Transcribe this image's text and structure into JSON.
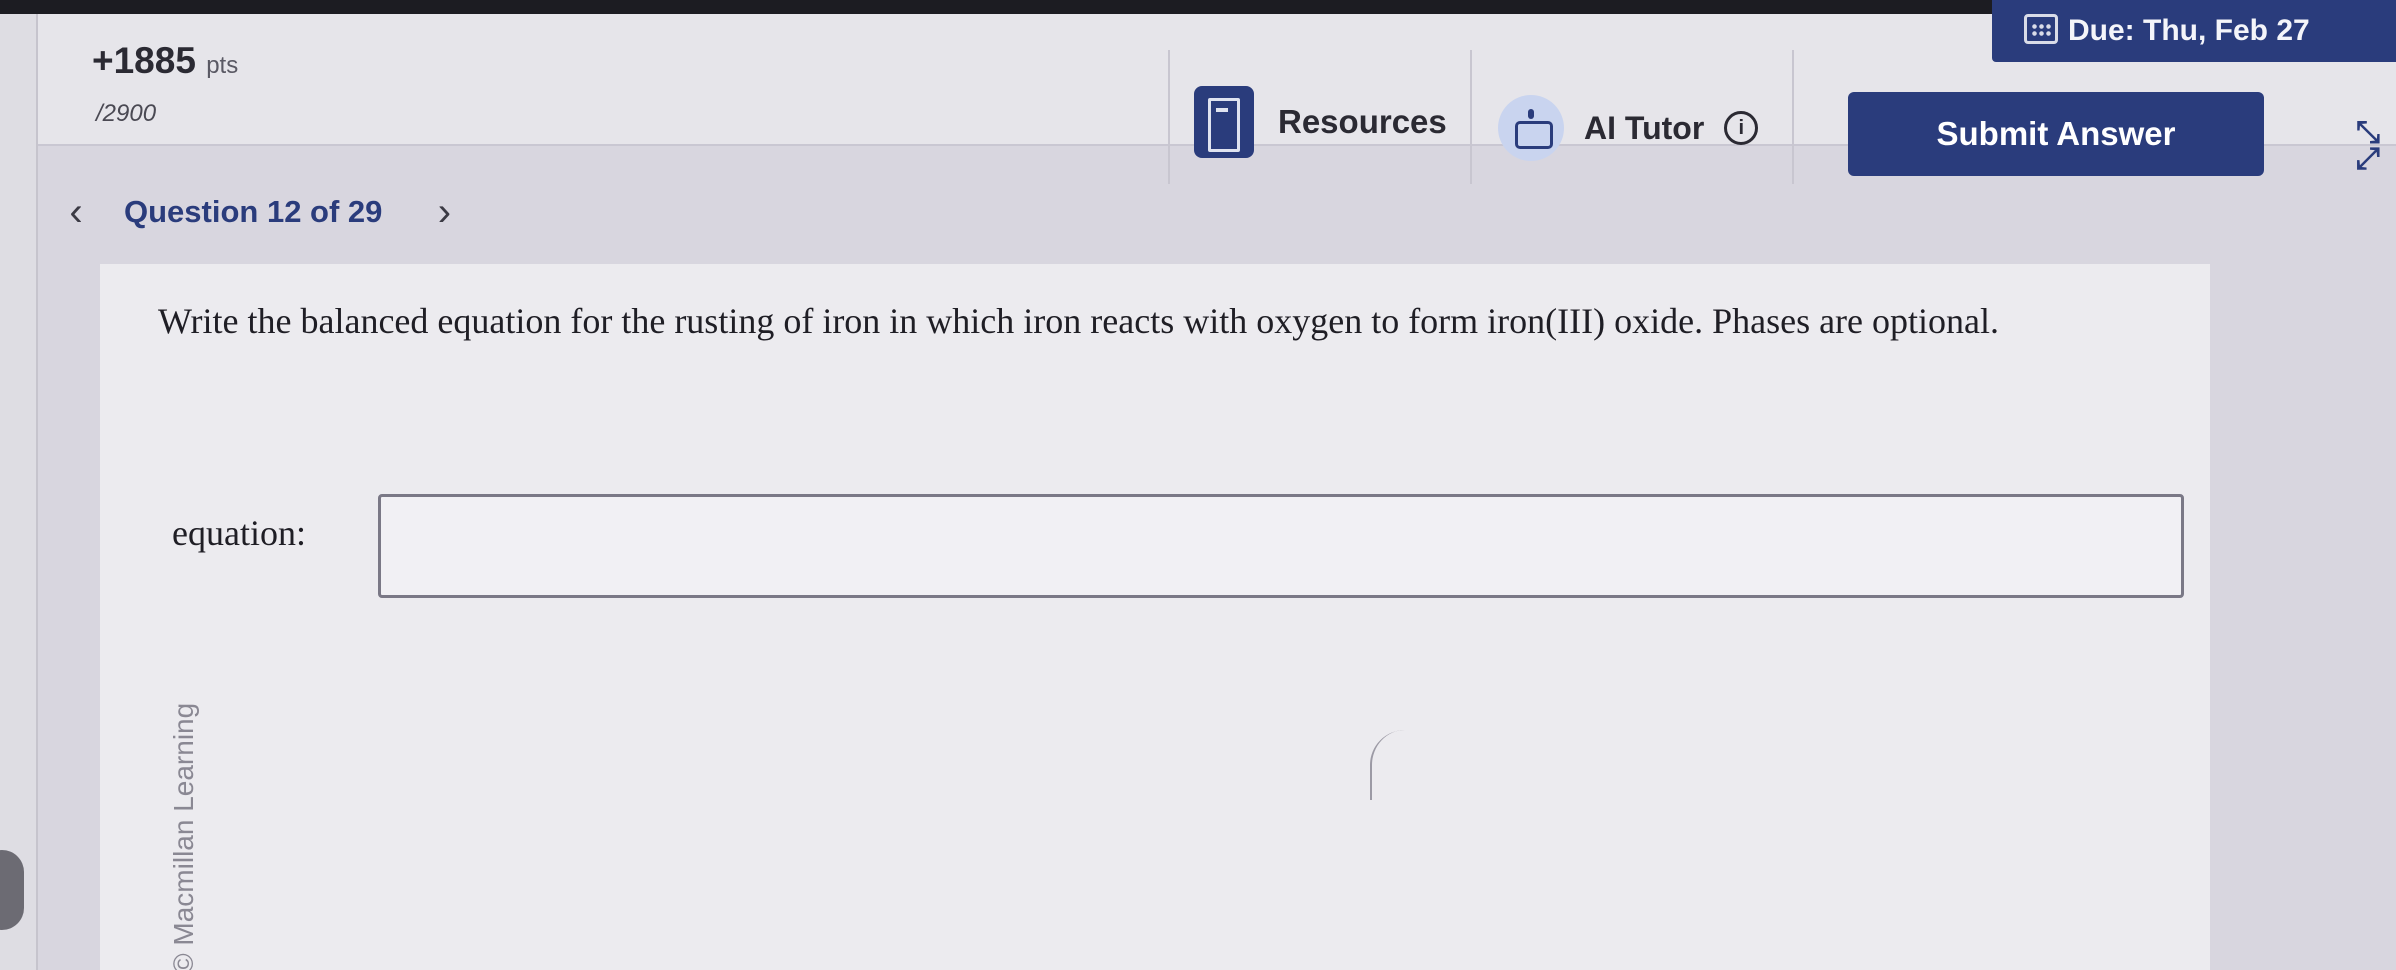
{
  "header": {
    "points": "+1885",
    "points_unit": "pts",
    "points_total": "/2900",
    "due_label": "Due: Thu, Feb 27",
    "resources_label": "Resources",
    "ai_tutor_label": "AI Tutor",
    "info_glyph": "i",
    "submit_label": "Submit Answer",
    "icons": [
      "calendar-icon",
      "book-icon",
      "robot-icon",
      "info-icon",
      "expand-icon"
    ]
  },
  "navigation": {
    "question_label": "Question 12 of 29",
    "prev_glyph": "‹",
    "next_glyph": "›"
  },
  "question": {
    "watermark": "© Macmillan Learning",
    "prompt": "Write the balanced equation for the rusting of iron in which iron reacts with oxygen to form iron(III) oxide. Phases are optional.",
    "answer_label": "equation:",
    "answer_value": ""
  },
  "colors": {
    "accent": "#2a3c7c",
    "background": "#d8d6df",
    "panel": "#ecebef"
  }
}
